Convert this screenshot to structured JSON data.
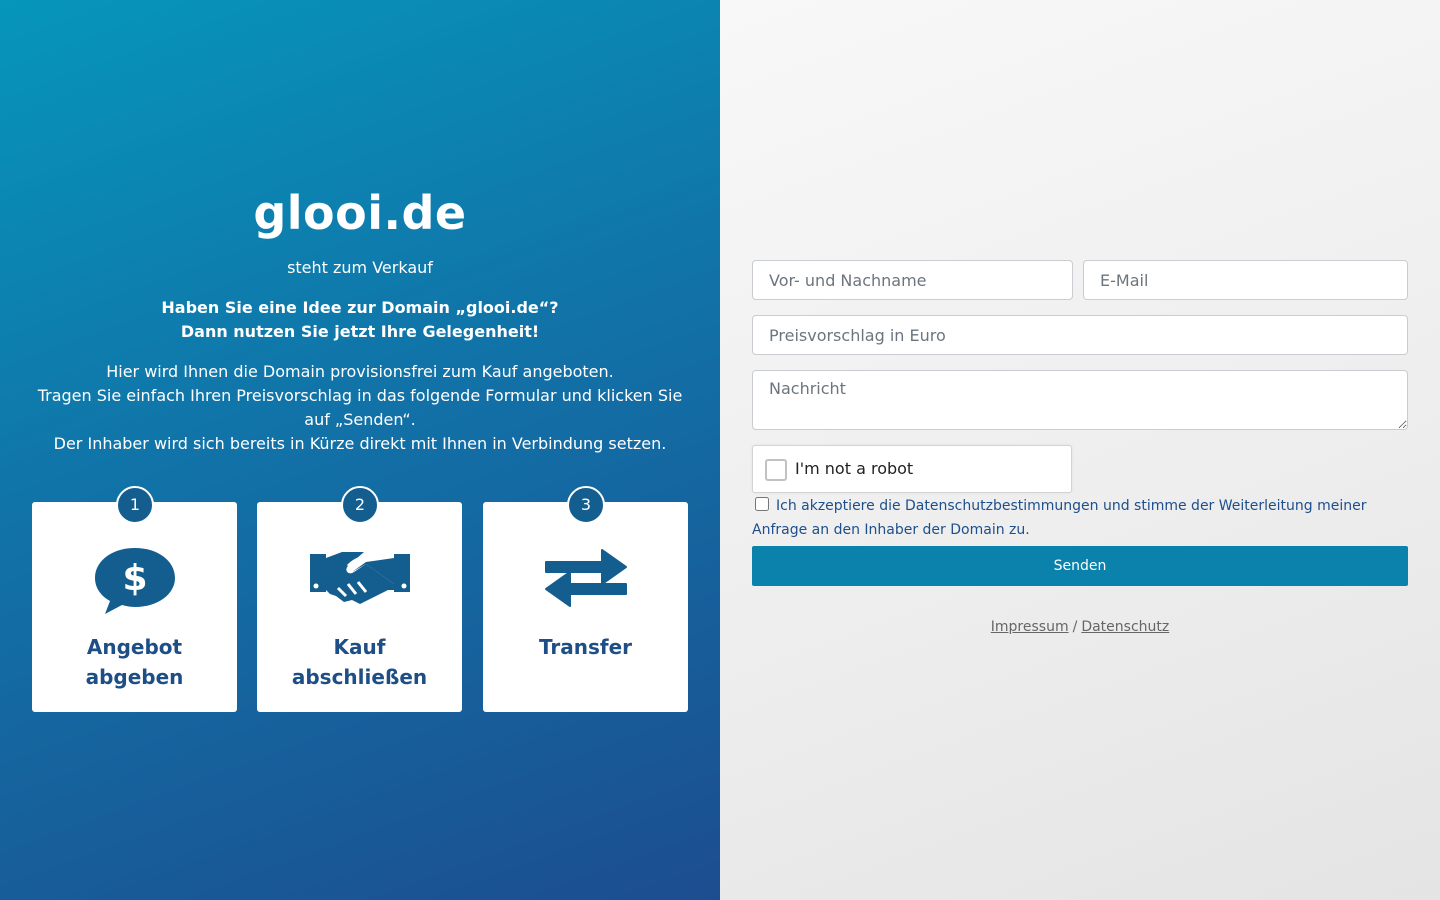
{
  "hero": {
    "domain": "glooi.de",
    "subtitle": "steht zum Verkauf",
    "headline_1": "Haben Sie eine Idee zur Domain „glooi.de“?",
    "headline_2": "Dann nutzen Sie jetzt Ihre Gelegenheit!",
    "desc_1": "Hier wird Ihnen die Domain provisionsfrei zum Kauf angeboten.",
    "desc_2": "Tragen Sie einfach Ihren Preisvorschlag in das folgende Formular und klicken Sie auf „Senden“.",
    "desc_3": "Der Inhaber wird sich bereits in Kürze direkt mit Ihnen in Verbindung setzen."
  },
  "steps": [
    {
      "num": "1",
      "label_1": "Angebot",
      "label_2": "abgeben",
      "icon": "dollar-speech-bubble-icon"
    },
    {
      "num": "2",
      "label_1": "Kauf",
      "label_2": "abschließen",
      "icon": "handshake-icon"
    },
    {
      "num": "3",
      "label_1": "Transfer",
      "label_2": "",
      "icon": "transfer-arrows-icon"
    }
  ],
  "form": {
    "name_placeholder": "Vor- und Nachname",
    "email_placeholder": "E-Mail",
    "price_placeholder": "Preisvorschlag in Euro",
    "message_placeholder": "Nachricht",
    "captcha_label": "I'm not a robot",
    "consent": "Ich akzeptiere die Datenschutzbestimmungen und stimme der Weiterleitung meiner Anfrage an den Inhaber der Domain zu.",
    "submit_label": "Senden"
  },
  "footer": {
    "impressum": "Impressum",
    "separator": "/",
    "datenschutz": "Datenschutz"
  },
  "colors": {
    "gradient_start": "#0696bb",
    "gradient_end": "#1c4d90",
    "step_label": "#1e4e86",
    "icon": "#145e8f",
    "submit_button": "#0a82ab"
  }
}
